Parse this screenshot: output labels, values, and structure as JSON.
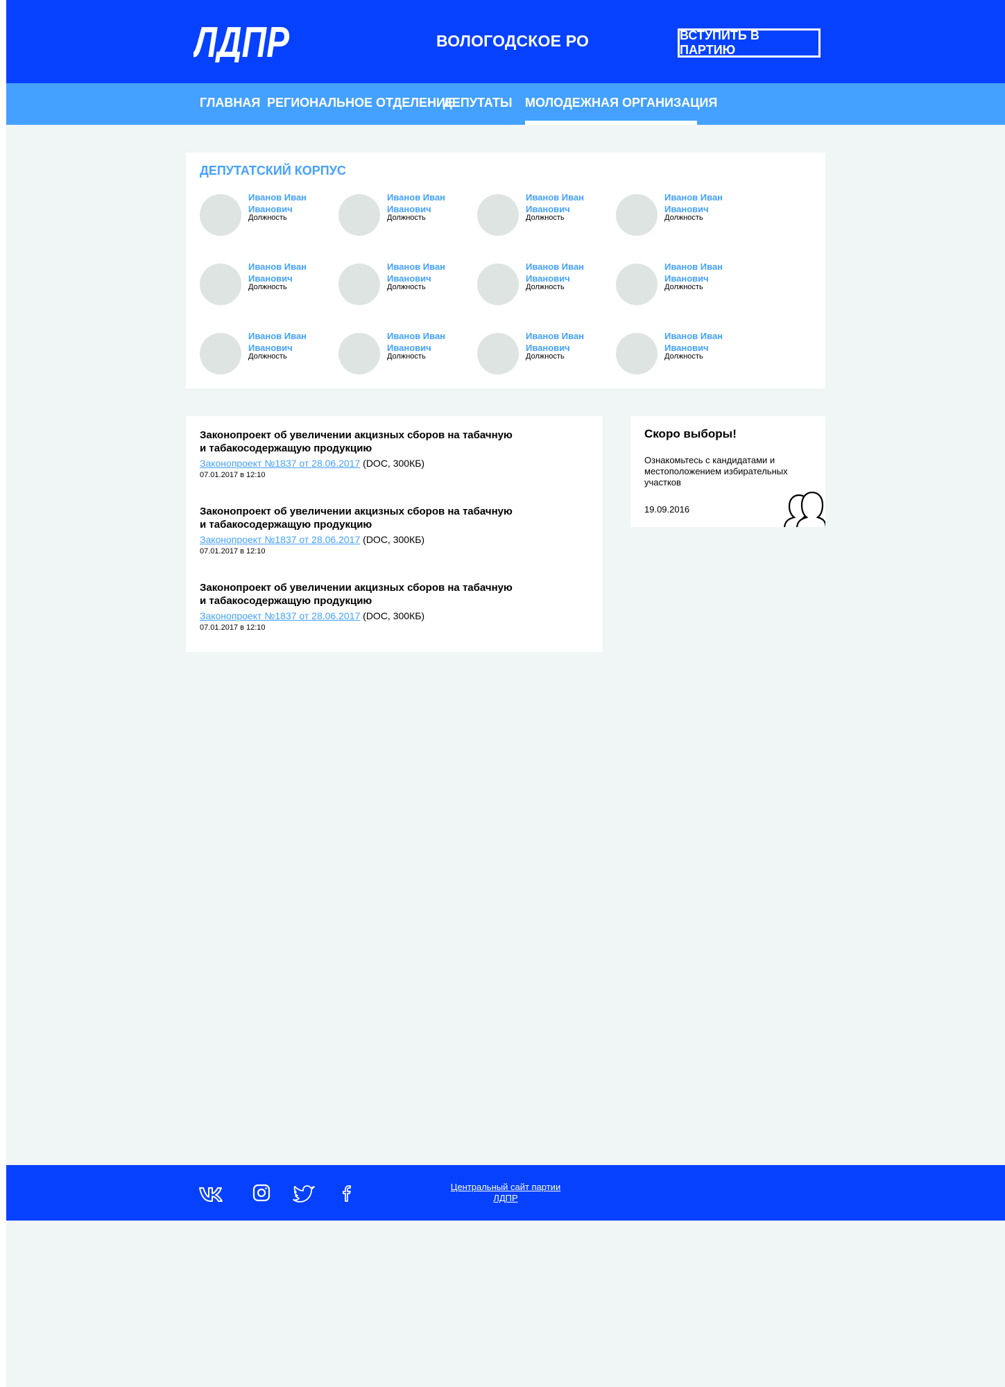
{
  "header": {
    "logo_text": "ЛДПР",
    "region_title": "ВОЛОГОДСКОЕ РО",
    "join_button": "ВСТУПИТЬ В ПАРТИЮ"
  },
  "nav": {
    "items": [
      {
        "label": "ГЛАВНАЯ"
      },
      {
        "label": "РЕГИОНАЛЬНОЕ ОТДЕЛЕНИЕ"
      },
      {
        "label": "ДЕПУТАТЫ"
      },
      {
        "label": "МОЛОДЕЖНАЯ ОРГАНИЗАЦИЯ"
      }
    ],
    "active_index": 3,
    "search_icon": "search-icon"
  },
  "deputies": {
    "title": "ДЕПУТАТСКИЙ КОРПУС",
    "items": [
      {
        "name": "Иванов Иван Иванович",
        "role": "Должность"
      },
      {
        "name": "Иванов Иван Иванович",
        "role": "Должность"
      },
      {
        "name": "Иванов Иван Иванович",
        "role": "Должность"
      },
      {
        "name": "Иванов Иван Иванович",
        "role": "Должность"
      },
      {
        "name": "Иванов Иван Иванович",
        "role": "Должность"
      },
      {
        "name": "Иванов Иван Иванович",
        "role": "Должность"
      },
      {
        "name": "Иванов Иван Иванович",
        "role": "Должность"
      },
      {
        "name": "Иванов Иван Иванович",
        "role": "Должность"
      },
      {
        "name": "Иванов Иван Иванович",
        "role": "Должность"
      },
      {
        "name": "Иванов Иван Иванович",
        "role": "Должность"
      },
      {
        "name": "Иванов Иван Иванович",
        "role": "Должность"
      },
      {
        "name": "Иванов Иван Иванович",
        "role": "Должность"
      }
    ]
  },
  "documents": {
    "items": [
      {
        "title": "Законопроект об увеличении акцизных сборов на табачную и табакосодержащую продукцию",
        "link": "Законопроект №1837 от 28.06.2017",
        "meta": "(DOC, 300КБ)",
        "date": "07.01.2017 в 12:10"
      },
      {
        "title": "Законопроект об увеличении акцизных сборов на табачную и табакосодержащую продукцию",
        "link": "Законопроект №1837 от 28.06.2017",
        "meta": "(DOC, 300КБ)",
        "date": "07.01.2017 в 12:10"
      },
      {
        "title": "Законопроект об увеличении акцизных сборов на табачную и табакосодержащую продукцию",
        "link": "Законопроект №1837 от 28.06.2017",
        "meta": "(DOC, 300КБ)",
        "date": "07.01.2017 в 12:10"
      }
    ]
  },
  "elections": {
    "title": "Скоро выборы!",
    "description": "Ознакомьтесь с кандидатами и местоположением избирательных участков",
    "date": "19.09.2016",
    "icon": "people-icon"
  },
  "footer": {
    "social": [
      "vk-icon",
      "instagram-icon",
      "twitter-icon",
      "facebook-icon"
    ],
    "central_link": "Центральный сайт партии ЛДПР"
  },
  "colors": {
    "primary": "#0541ff",
    "nav": "#44a1ff",
    "accent_text": "#44a1ff",
    "background": "#f0f5f5",
    "avatar": "#dde4e1"
  }
}
